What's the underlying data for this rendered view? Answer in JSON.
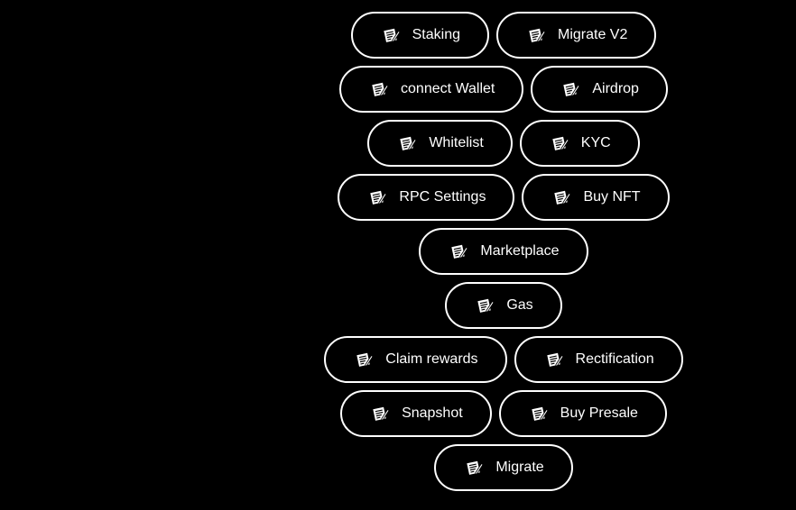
{
  "colors": {
    "background": "#000000",
    "button_border": "#ffffff",
    "button_text": "#ffffff"
  },
  "button_icon": "memo-icon",
  "rows": [
    [
      "Staking",
      "Migrate V2"
    ],
    [
      "connect Wallet",
      "Airdrop"
    ],
    [
      "Whitelist",
      "KYC"
    ],
    [
      "RPC Settings",
      "Buy NFT"
    ],
    [
      "Marketplace"
    ],
    [
      "Gas"
    ],
    [
      "Claim rewards",
      "Rectification"
    ],
    [
      "Snapshot",
      "Buy Presale"
    ],
    [
      "Migrate"
    ]
  ]
}
